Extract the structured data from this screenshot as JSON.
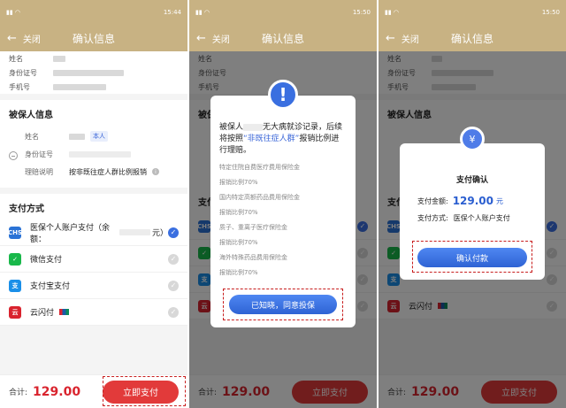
{
  "screens": [
    {
      "time": "15:44"
    },
    {
      "time": "15:50"
    },
    {
      "time": "15:50"
    }
  ],
  "nav": {
    "back": "关闭",
    "title": "确认信息"
  },
  "policyholder": {
    "name_label": "姓名",
    "id_label": "身份证号",
    "phone_label": "手机号"
  },
  "insured": {
    "title": "被保人信息",
    "name_label": "姓名",
    "self_badge": "本人",
    "id_label": "身份证号",
    "claim_label": "理赔说明",
    "claim_value": "按非既往症人群比例报销"
  },
  "payment": {
    "title": "支付方式",
    "methods": [
      {
        "name": "医保个人账户支付（余额：",
        "suffix": "元）",
        "icon": "medical-insurance-icon",
        "checked": true
      },
      {
        "name": "微信支付",
        "icon": "wechat-icon",
        "checked": false
      },
      {
        "name": "支付宝支付",
        "icon": "alipay-icon",
        "checked": false
      },
      {
        "name": "云闪付",
        "icon": "unionpay-icon",
        "checked": false
      }
    ]
  },
  "footer": {
    "total_label": "合计:",
    "total_amount": "129.00",
    "pay_button": "立即支付"
  },
  "modal_notice": {
    "text_a": "被保人",
    "text_b": "无大病就诊记录，后续将按照",
    "link": "“非既往症人群”",
    "text_c": "报销比例进行理赔。",
    "items": [
      "特定住院自费医疗费用保险金",
      "报销比例70%",
      "国内特定高额药品费用保险金",
      "报销比例70%",
      "质子、重离子医疗保险金",
      "报销比例70%",
      "海外特殊药品费用保险金",
      "报销比例70%"
    ],
    "button": "已知晓，同意投保"
  },
  "modal_confirm": {
    "title": "支付确认",
    "amount_label": "支付金额:",
    "amount": "129.00",
    "unit": "元",
    "method_label": "支付方式:",
    "method": "医保个人账户支付",
    "button": "确认付款"
  },
  "colors": {
    "header": "#c8b283",
    "primary": "#3a6fe0",
    "pay": "#e23a3a",
    "highlight": "#c81e1e"
  }
}
